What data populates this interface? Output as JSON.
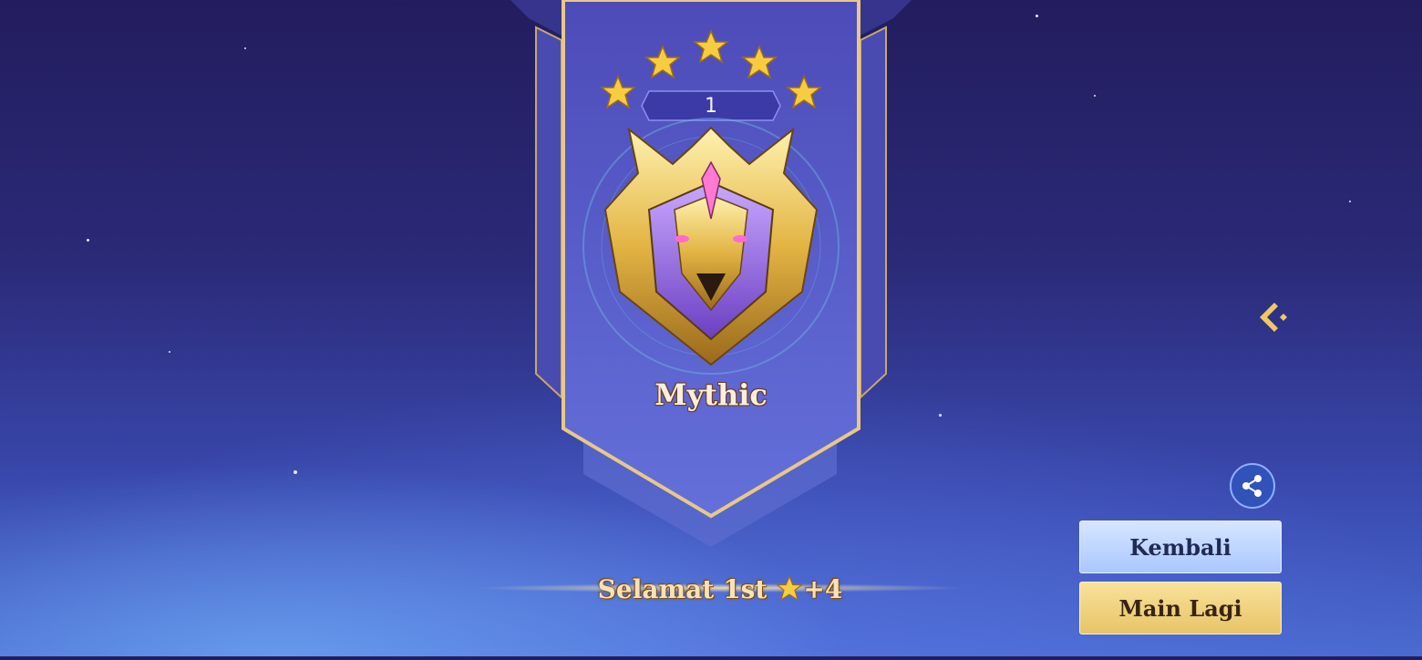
{
  "rank": {
    "name": "Mythic",
    "level": "1",
    "stars_count": 5
  },
  "result": {
    "congrats_text": "Selamat",
    "placement": "1st",
    "star_gain": "+4"
  },
  "buttons": {
    "back_label": "Kembali",
    "play_again_label": "Main Lagi"
  },
  "icons": {
    "back": "back-arrow-icon",
    "share": "share-icon",
    "star": "star-icon",
    "emblem": "mythic-emblem-icon"
  },
  "colors": {
    "gold": "#f2c84b",
    "banner": "#5a5bc9",
    "banner_border": "#e8c886"
  }
}
